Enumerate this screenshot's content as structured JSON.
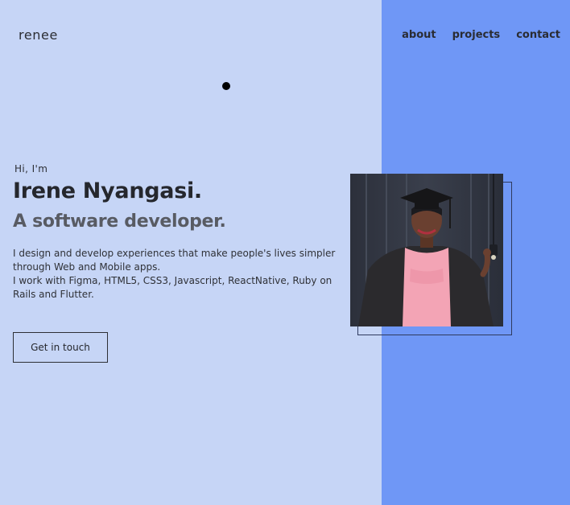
{
  "header": {
    "logo": "renee",
    "nav": [
      {
        "label": "about"
      },
      {
        "label": "projects"
      },
      {
        "label": "contact"
      }
    ]
  },
  "hero": {
    "greeting": "Hi, I'm",
    "name": "Irene Nyangasi.",
    "role": "A software developer.",
    "bio_lines": [
      "I design and develop experiences that make people's lives simpler through Web and Mobile apps.",
      "I work with Figma, HTML5, CSS3, Javascript, ReactNative, Ruby on Rails and Flutter."
    ],
    "cta_label": "Get in touch"
  },
  "colors": {
    "left_background": "#c6d5f6",
    "right_background": "#6f97f6",
    "text_dark": "#25272d",
    "text_muted": "#585b63"
  },
  "icons": {
    "indicator": "dot-icon"
  }
}
